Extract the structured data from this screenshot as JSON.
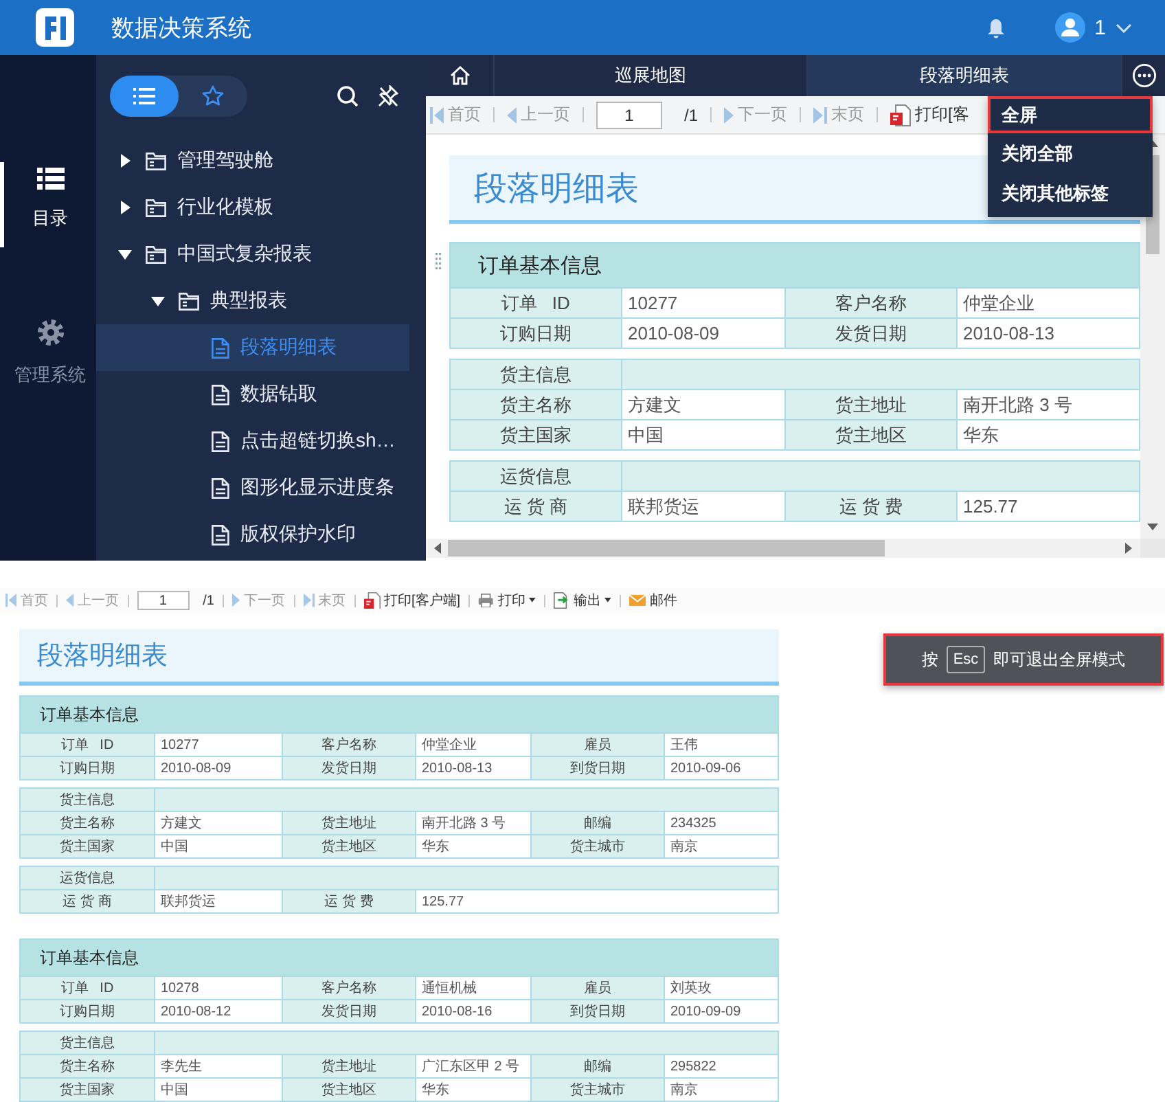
{
  "header": {
    "title": "数据决策系统",
    "user": "1"
  },
  "rail": [
    {
      "kind": "catalog",
      "label": "目录",
      "selected": true
    },
    {
      "kind": "settings",
      "label": "管理系统",
      "selected": false
    }
  ],
  "sidebar": {
    "views": [
      {
        "kind": "list",
        "selected": true
      },
      {
        "kind": "favorites",
        "selected": false
      }
    ],
    "tree": [
      {
        "kind": "folder",
        "label": "管理驾驶舱",
        "expanded": false
      },
      {
        "kind": "folder",
        "label": "行业化模板",
        "expanded": false
      },
      {
        "kind": "folder",
        "label": "中国式复杂报表",
        "expanded": true,
        "children": [
          {
            "kind": "folder",
            "label": "典型报表",
            "expanded": true,
            "children": [
              {
                "kind": "file",
                "label": "段落明细表",
                "selected": true
              },
              {
                "kind": "file",
                "label": "数据钻取",
                "selected": false
              },
              {
                "kind": "file",
                "label": "点击超链切换sh…",
                "selected": false
              },
              {
                "kind": "file",
                "label": "图形化显示进度条",
                "selected": false
              },
              {
                "kind": "file",
                "label": "版权保护水印",
                "selected": false
              }
            ]
          }
        ]
      }
    ]
  },
  "tabs": [
    {
      "kind": "home",
      "selected": false
    },
    {
      "kind": "page",
      "label": "巡展地图",
      "selected": false
    },
    {
      "kind": "page",
      "label": "段落明细表",
      "selected": true
    }
  ],
  "tab_menu": [
    {
      "label": "全屏",
      "outlined": true
    },
    {
      "label": "关闭全部",
      "outlined": false
    },
    {
      "label": "关闭其他标签",
      "outlined": false
    }
  ],
  "toolbar": [
    {
      "kind": "first",
      "label": "首页",
      "disabled": true
    },
    {
      "kind": "prev",
      "label": "上一页",
      "disabled": true
    },
    {
      "kind": "page",
      "value": "1"
    },
    {
      "kind": "total",
      "label": "/1"
    },
    {
      "kind": "next",
      "label": "下一页",
      "disabled": true
    },
    {
      "kind": "last",
      "label": "末页",
      "disabled": true
    },
    {
      "kind": "print-client",
      "label": "打印[客",
      "disabled": false
    }
  ],
  "report": {
    "title": "段落明细表",
    "groups": [
      {
        "blocks": [
          {
            "heading": "订单基本信息",
            "rows": [
              [
                "订单   ID",
                "10277",
                "客户名称",
                "仲堂企业"
              ],
              [
                "订购日期",
                "2010-08-09",
                "发货日期",
                "2010-08-13"
              ]
            ]
          },
          {
            "rows": [
              [
                "货主信息"
              ],
              [
                "货主名称",
                "方建文",
                "货主地址",
                "南开北路 3 号"
              ],
              [
                "货主国家",
                "中国",
                "货主地区",
                "华东"
              ]
            ]
          },
          {
            "rows": [
              [
                "运货信息"
              ],
              [
                "运 货 商",
                "联邦货运",
                "运 货 费",
                "125.77"
              ]
            ]
          }
        ]
      }
    ]
  },
  "fullscreen": {
    "toolbar": [
      {
        "kind": "first",
        "label": "首页",
        "disabled": true
      },
      {
        "kind": "prev",
        "label": "上一页",
        "disabled": true
      },
      {
        "kind": "page",
        "value": "1"
      },
      {
        "kind": "total",
        "label": "/1"
      },
      {
        "kind": "next",
        "label": "下一页",
        "disabled": true
      },
      {
        "kind": "last",
        "label": "末页",
        "disabled": true
      },
      {
        "kind": "print-client",
        "label": "打印[客户端]",
        "disabled": false
      },
      {
        "kind": "print",
        "label": "打印",
        "disabled": false,
        "dropdown": true
      },
      {
        "kind": "export",
        "label": "输出",
        "disabled": false,
        "dropdown": true
      },
      {
        "kind": "mail",
        "label": "邮件",
        "disabled": false
      }
    ],
    "notice": {
      "before": "按",
      "key": "Esc",
      "after": "即可退出全屏模式",
      "outlined": true
    },
    "report": {
      "title": "段落明细表",
      "groups": [
        {
          "blocks": [
            {
              "heading": "订单基本信息",
              "rows": [
                [
                  "订单   ID",
                  "10277",
                  "客户名称",
                  "仲堂企业",
                  "雇员",
                  "王伟"
                ],
                [
                  "订购日期",
                  "2010-08-09",
                  "发货日期",
                  "2010-08-13",
                  "到货日期",
                  "2010-09-06"
                ]
              ]
            },
            {
              "rows": [
                [
                  "货主信息"
                ],
                [
                  "货主名称",
                  "方建文",
                  "货主地址",
                  "南开北路 3 号",
                  "邮编",
                  "234325"
                ],
                [
                  "货主国家",
                  "中国",
                  "货主地区",
                  "华东",
                  "货主城市",
                  "南京"
                ]
              ]
            },
            {
              "rows": [
                [
                  "运货信息"
                ],
                [
                  "运 货 商",
                  "联邦货运",
                  "运 货 费",
                  "125.77"
                ]
              ]
            }
          ]
        },
        {
          "blocks": [
            {
              "heading": "订单基本信息",
              "rows": [
                [
                  "订单   ID",
                  "10278",
                  "客户名称",
                  "通恒机械",
                  "雇员",
                  "刘英玫"
                ],
                [
                  "订购日期",
                  "2010-08-12",
                  "发货日期",
                  "2010-08-16",
                  "到货日期",
                  "2010-09-09"
                ]
              ]
            },
            {
              "rows": [
                [
                  "货主信息"
                ],
                [
                  "货主名称",
                  "李先生",
                  "货主地址",
                  "广汇东区甲 2 号",
                  "邮编",
                  "295822"
                ],
                [
                  "货主国家",
                  "中国",
                  "货主地区",
                  "华东",
                  "货主城市",
                  "南京"
                ]
              ]
            }
          ]
        }
      ]
    }
  }
}
